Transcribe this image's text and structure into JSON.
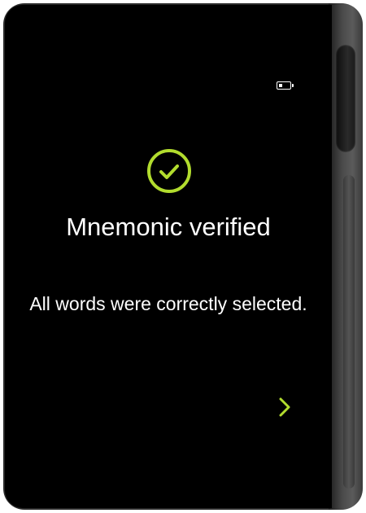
{
  "status": {
    "battery_level": 0.35,
    "battery_icon": "battery-icon"
  },
  "screen": {
    "status_icon": "check-circle-icon",
    "title": "Mnemonic verified",
    "message": "All words were correctly selected.",
    "next_icon": "chevron-right-icon"
  },
  "colors": {
    "accent": "#b2dc2e",
    "background": "#000000",
    "text": "#ffffff"
  }
}
